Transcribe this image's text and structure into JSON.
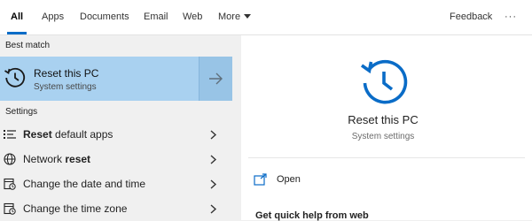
{
  "tabs": {
    "items": [
      {
        "label": "All"
      },
      {
        "label": "Apps"
      },
      {
        "label": "Documents"
      },
      {
        "label": "Email"
      },
      {
        "label": "Web"
      },
      {
        "label": "More"
      }
    ],
    "feedback": "Feedback",
    "overflow": "···"
  },
  "left": {
    "best_match_heading": "Best match",
    "best_match": {
      "title": "Reset this PC",
      "subtitle": "System settings",
      "icon": "history-reset-icon"
    },
    "settings_heading": "Settings",
    "settings": [
      {
        "bold": "Reset",
        "rest": " default apps",
        "icon": "list-apps-icon"
      },
      {
        "pre": "Network ",
        "bold": "reset",
        "icon": "globe-icon"
      },
      {
        "pre": "Change the date and time",
        "icon": "calendar-clock-icon"
      },
      {
        "pre": "Change the time zone",
        "icon": "calendar-clock-icon"
      }
    ]
  },
  "preview": {
    "title": "Reset this PC",
    "subtitle": "System settings",
    "open_label": "Open",
    "help_text": "Get quick help from web"
  },
  "colors": {
    "accent": "#0a6cc7",
    "selected_bg": "#a9d1f0"
  }
}
